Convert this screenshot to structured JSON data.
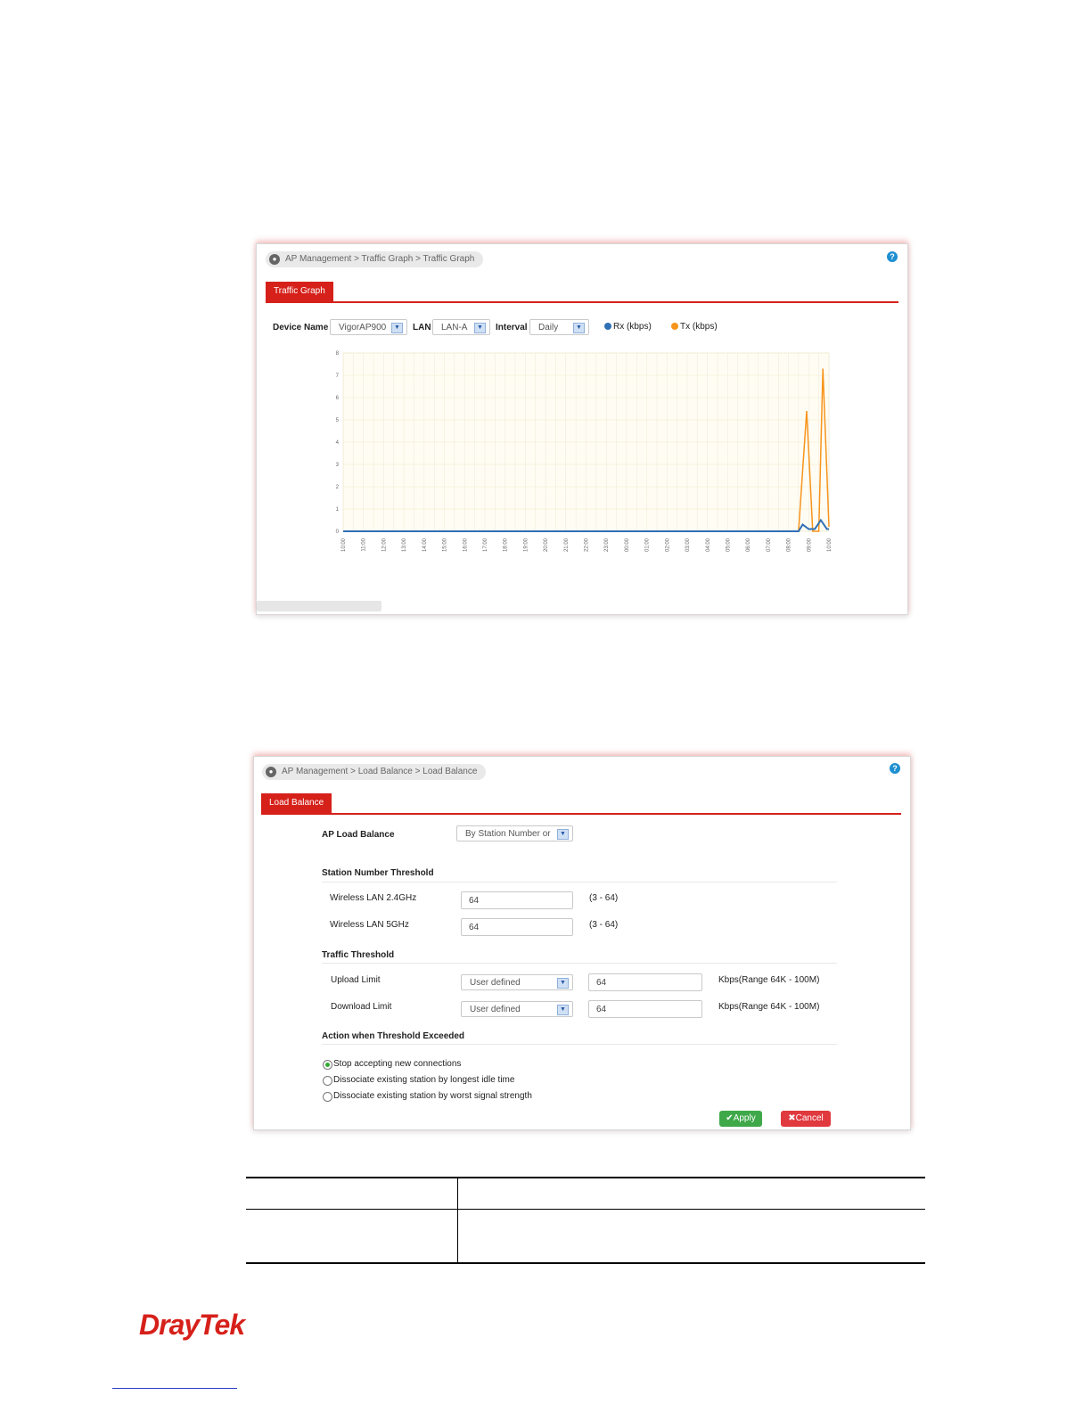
{
  "traffic_graph": {
    "breadcrumb": "AP Management > Traffic Graph > Traffic Graph",
    "help": "?",
    "tab": "Traffic Graph",
    "device_name_label": "Device Name",
    "device_name_value": "VigorAP900",
    "lan_label": "LAN",
    "lan_value": "LAN-A",
    "interval_label": "Interval",
    "interval_value": "Daily",
    "colors": {
      "rx": "#2f6fb5",
      "tx": "#f7941d",
      "accent": "#d6201a"
    }
  },
  "chart_data": {
    "type": "line",
    "y_ticks": [
      "0",
      "1",
      "2",
      "3",
      "4",
      "5",
      "6",
      "7",
      "8"
    ],
    "ylim": [
      0,
      8
    ],
    "x_ticks": [
      "10:00",
      "11:00",
      "12:00",
      "13:00",
      "14:00",
      "15:00",
      "16:00",
      "17:00",
      "18:00",
      "19:00",
      "20:00",
      "21:00",
      "22:00",
      "23:00",
      "00:00",
      "01:00",
      "02:00",
      "03:00",
      "04:00",
      "05:00",
      "06:00",
      "07:00",
      "08:00",
      "09:00",
      "10:00"
    ],
    "series": [
      {
        "name": "Rx (kbps)",
        "color": "#2f6fb5",
        "x": [
          0,
          22.5,
          22.7,
          23.0,
          23.3,
          23.6,
          23.9,
          24.0
        ],
        "y": [
          0,
          0,
          0.3,
          0.1,
          0.1,
          0.5,
          0.1,
          0.1
        ]
      },
      {
        "name": "Tx (kbps)",
        "color": "#f7941d",
        "x": [
          0,
          22.5,
          22.9,
          23.2,
          23.5,
          23.7,
          24.0
        ],
        "y": [
          0,
          0,
          5.4,
          0,
          0,
          7.3,
          0.2
        ]
      }
    ]
  },
  "load_balance": {
    "breadcrumb": "AP Management > Load Balance > Load Balance",
    "help": "?",
    "tab": "Load Balance",
    "ap_load_balance_label": "AP Load Balance",
    "ap_load_balance_value": "By Station Number or",
    "station_threshold_title": "Station Number Threshold",
    "wlan24_label": "Wireless LAN 2.4GHz",
    "wlan24_value": "64",
    "wlan24_range": "(3 - 64)",
    "wlan5_label": "Wireless LAN 5GHz",
    "wlan5_value": "64",
    "wlan5_range": "(3 - 64)",
    "traffic_threshold_title": "Traffic Threshold",
    "upload_label": "Upload Limit",
    "upload_mode": "User defined",
    "upload_value": "64",
    "upload_range": "Kbps(Range 64K - 100M)",
    "download_label": "Download Limit",
    "download_mode": "User defined",
    "download_value": "64",
    "download_range": "Kbps(Range 64K - 100M)",
    "action_title": "Action when Threshold Exceeded",
    "options": [
      {
        "label": "Stop accepting new connections",
        "selected": true
      },
      {
        "label": "Dissociate existing station by longest idle time",
        "selected": false
      },
      {
        "label": "Dissociate existing station by worst signal strength",
        "selected": false
      }
    ],
    "apply_label": "Apply",
    "cancel_label": "Cancel"
  },
  "footer": {
    "logo": "DrayTek"
  }
}
